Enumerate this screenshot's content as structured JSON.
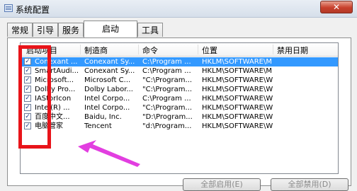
{
  "window": {
    "title": "系统配置",
    "close_label": "✕"
  },
  "tabs": [
    {
      "label": "常规"
    },
    {
      "label": "引导"
    },
    {
      "label": "服务"
    },
    {
      "label": "启动",
      "active": true
    },
    {
      "label": "工具"
    }
  ],
  "columns": [
    "启动项目",
    "制造商",
    "命令",
    "位置",
    "禁用日期"
  ],
  "rows": [
    {
      "checked": true,
      "item": "Conexant ...",
      "maker": "Conexant Sy...",
      "command": "C:\\Program ...",
      "location": "HKLM\\SOFTWARE\\M...",
      "selected": true
    },
    {
      "checked": true,
      "item": "SmartAudi...",
      "maker": "Conexant Sy...",
      "command": "C:\\Program ...",
      "location": "HKLM\\SOFTWARE\\M..."
    },
    {
      "checked": true,
      "item": "Microsoft...",
      "maker": "Microsoft C...",
      "command": "\"C:\\Program...",
      "location": "HKLM\\SOFTWARE\\W..."
    },
    {
      "checked": true,
      "item": "Dolby Pro...",
      "maker": "Dolby Labor...",
      "command": "\"C:\\Program...",
      "location": "HKLM\\SOFTWARE\\W..."
    },
    {
      "checked": true,
      "item": "IAStorIcon",
      "maker": "Intel Corpo...",
      "command": "C:\\Program ...",
      "location": "HKLM\\SOFTWARE\\W..."
    },
    {
      "checked": true,
      "item": "Intel(R) ...",
      "maker": "Intel Corpo...",
      "command": "\"C:\\Program...",
      "location": "HKLM\\SOFTWARE\\W..."
    },
    {
      "checked": true,
      "item": "百度中文...",
      "maker": "Baidu, Inc.",
      "command": "\"D:\\Program...",
      "location": "HKLM\\SOFTWARE\\W..."
    },
    {
      "checked": true,
      "item": "电脑管家",
      "maker": "Tencent",
      "command": "\"d:\\Program...",
      "location": "HKLM\\SOFTWARE\\W..."
    }
  ],
  "buttons": {
    "enable_all": "全部启用(E)",
    "disable_all": "全部禁用(D)"
  },
  "colors": {
    "selection": "#3399ff",
    "annotation_box": "#e8141a",
    "annotation_arrow": "#e23ee0"
  }
}
